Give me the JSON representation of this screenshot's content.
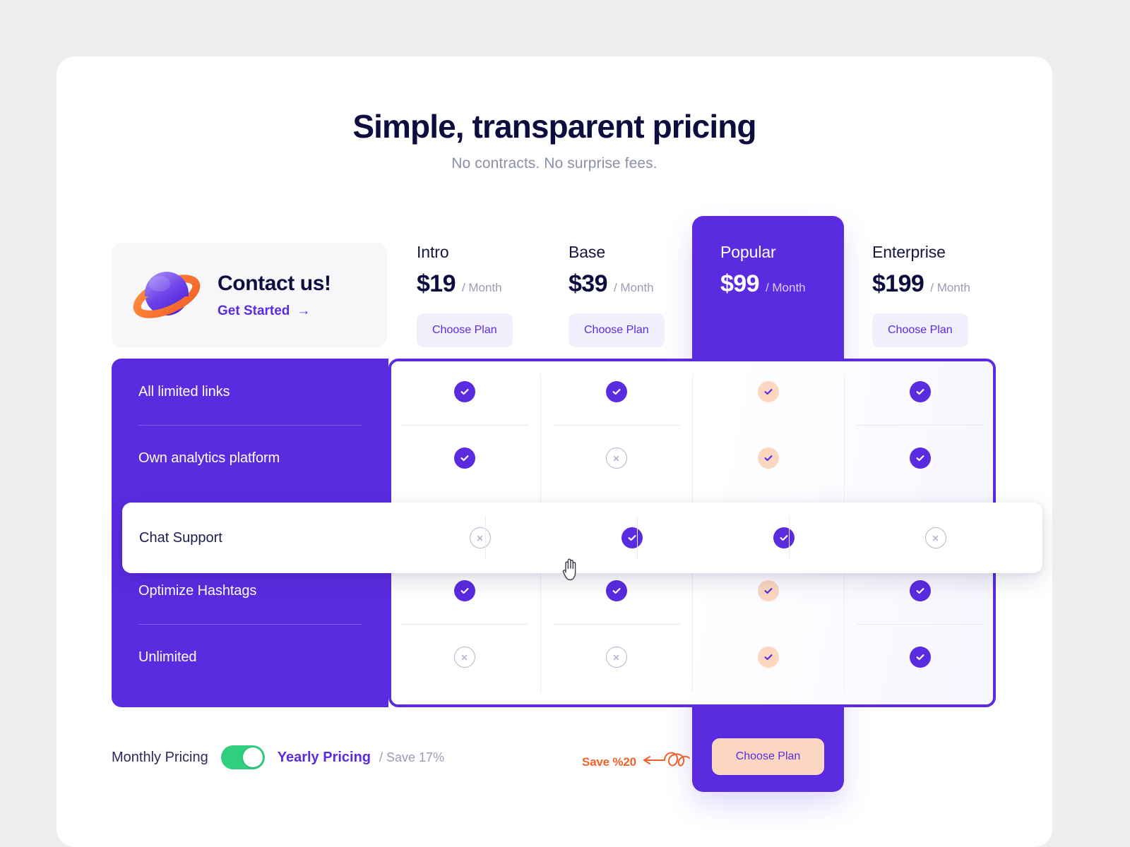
{
  "header": {
    "title": "Simple, transparent pricing",
    "subtitle": "No contracts. No surprise fees."
  },
  "contact": {
    "title": "Contact us!",
    "link_label": "Get Started",
    "arrow_glyph": "→",
    "icon": "planet-icon"
  },
  "plans": [
    {
      "name": "Intro",
      "price": "$19",
      "period": "/ Month",
      "cta": "Choose Plan",
      "highlighted": false
    },
    {
      "name": "Base",
      "price": "$39",
      "period": "/ Month",
      "cta": "Choose Plan",
      "highlighted": false
    },
    {
      "name": "Popular",
      "price": "$99",
      "period": "/ Month",
      "cta": "Choose Plan",
      "highlighted": true
    },
    {
      "name": "Enterprise",
      "price": "$199",
      "period": "/ Month",
      "cta": "Choose Plan",
      "highlighted": false
    }
  ],
  "features": [
    {
      "label": "All limited links",
      "values": [
        "check",
        "check",
        "check",
        "check"
      ],
      "highlighted": false
    },
    {
      "label": "Own analytics platform",
      "values": [
        "check",
        "cross",
        "check",
        "check"
      ],
      "highlighted": false
    },
    {
      "label": "Chat Support",
      "values": [
        "cross",
        "check",
        "check",
        "cross"
      ],
      "highlighted": true
    },
    {
      "label": "Optimize Hashtags",
      "values": [
        "check",
        "check",
        "check",
        "check"
      ],
      "highlighted": false
    },
    {
      "label": "Unlimited",
      "values": [
        "cross",
        "cross",
        "check",
        "check"
      ],
      "highlighted": false
    }
  ],
  "footer": {
    "monthly_label": "Monthly Pricing",
    "yearly_label": "Yearly Pricing",
    "save_label": "/ Save 17%",
    "toggle_state": "yearly",
    "annotation": "Save %20"
  },
  "colors": {
    "brand_purple": "#5B2BE0",
    "peach": "#FBD7C2",
    "navy": "#0D0D3F",
    "green": "#2FCF7F",
    "orange": "#F4602B",
    "muted": "#9A9CB4"
  }
}
